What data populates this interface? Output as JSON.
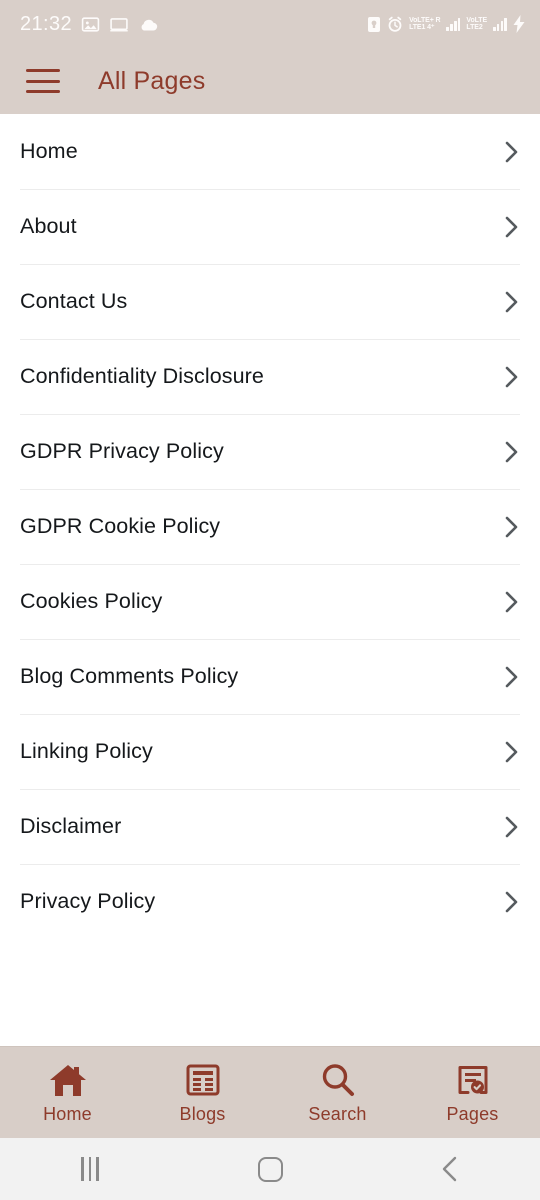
{
  "status_bar": {
    "time": "21:32",
    "left_icons": [
      "image-icon",
      "screen-cast-icon",
      "cloud-icon"
    ],
    "right_icons": [
      "sim-lock-icon",
      "alarm-icon",
      "charging-bolt-icon"
    ],
    "sim1_line1": "VoLTE+ R",
    "sim1_line2": "LTE1 4⁺",
    "sim2_line1": "VoLTE",
    "sim2_line2": "LTE2",
    "text_color": "#fdfbfa",
    "background": "#d9cfc9"
  },
  "header": {
    "menu_icon": "hamburger-menu-icon",
    "title": "All Pages",
    "accent_color": "#8e3b2b",
    "background": "#d9cfc9"
  },
  "page_list": {
    "chevron_icon": "chevron-right-icon",
    "items": [
      {
        "label": "Home"
      },
      {
        "label": "About"
      },
      {
        "label": "Contact Us"
      },
      {
        "label": "Confidentiality Disclosure"
      },
      {
        "label": "GDPR Privacy Policy"
      },
      {
        "label": "GDPR Cookie Policy"
      },
      {
        "label": "Cookies Policy"
      },
      {
        "label": "Blog Comments Policy"
      },
      {
        "label": "Linking Policy"
      },
      {
        "label": "Disclaimer"
      },
      {
        "label": "Privacy Policy"
      }
    ]
  },
  "tab_bar": {
    "background": "#d8cec8",
    "accent_color": "#8e3b2b",
    "active_tab": "Pages",
    "tabs": [
      {
        "label": "Home",
        "icon": "home-icon"
      },
      {
        "label": "Blogs",
        "icon": "newspaper-icon"
      },
      {
        "label": "Search",
        "icon": "search-icon"
      },
      {
        "label": "Pages",
        "icon": "document-check-icon"
      }
    ]
  },
  "system_nav": {
    "background": "#f2f2f2",
    "buttons": [
      {
        "name": "recents",
        "icon": "recents-icon"
      },
      {
        "name": "home",
        "icon": "home-square-icon"
      },
      {
        "name": "back",
        "icon": "back-chevron-icon"
      }
    ]
  }
}
